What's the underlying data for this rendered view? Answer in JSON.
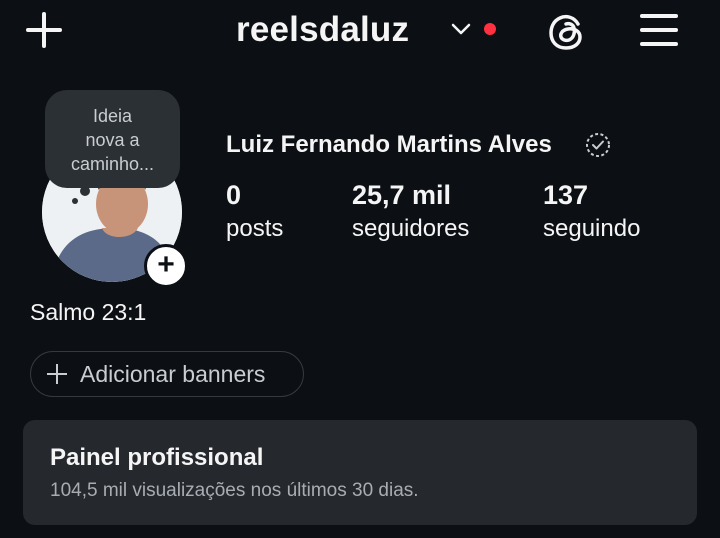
{
  "header": {
    "username": "reelsdaluz",
    "icons": {
      "create": "plus-icon",
      "switch_account": "chevron-down-icon",
      "threads": "threads-icon",
      "menu": "hamburger-menu-icon"
    },
    "notification_dot_color": "#ff3040"
  },
  "profile": {
    "note_lines": [
      "Ideia",
      "nova a",
      "caminho..."
    ],
    "full_name": "Luiz Fernando Martins Alves",
    "stats": [
      {
        "value": "0",
        "label": "posts"
      },
      {
        "value": "25,7 mil",
        "label": "seguidores"
      },
      {
        "value": "137",
        "label": "seguindo"
      }
    ],
    "bio": "Salmo 23:1",
    "add_banners_label": "Adicionar banners"
  },
  "dashboard": {
    "title": "Painel profissional",
    "subtitle": "104,5 mil visualizações nos últimos 30 dias."
  },
  "colors": {
    "background": "#0c1014",
    "panel": "#25292e",
    "text": "#f5f5f5"
  }
}
